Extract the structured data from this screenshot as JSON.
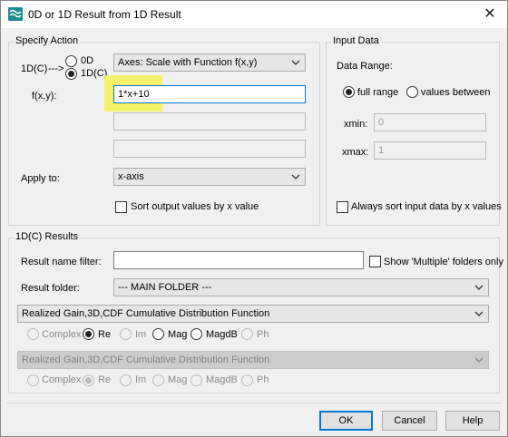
{
  "window": {
    "title": "0D or 1D Result from 1D Result",
    "close_glyph": "✕"
  },
  "specify_action": {
    "group_label": "Specify Action",
    "source_label": "1D(C)",
    "arrow": "--->",
    "radio_0d": "0D",
    "radio_1dc": "1D(C)",
    "action_select": "Axes: Scale with Function f(x,y)",
    "fxy_label": "f(x,y):",
    "fxy_value": "1*x+10",
    "apply_to_label": "Apply to:",
    "apply_to_select": "x-axis",
    "sort_output_label": "Sort output values by x value"
  },
  "input_data": {
    "group_label": "Input Data",
    "data_range_label": "Data Range:",
    "full_range_label": "full range",
    "values_between_label": "values between",
    "xmin_label": "xmin:",
    "xmin_value": "0",
    "xmax_label": "xmax:",
    "xmax_value": "1",
    "always_sort_label": "Always sort input data by x values"
  },
  "results": {
    "group_label": "1D(C) Results",
    "name_filter_label": "Result name filter:",
    "name_filter_value": "",
    "multiple_only_label": "Show 'Multiple' folders only",
    "folder_label": "Result folder:",
    "folder_select": "--- MAIN FOLDER ---",
    "result1_select": "Realized Gain,3D,CDF Cumulative Distribution Function",
    "result2_select": "Realized Gain,3D,CDF Cumulative Distribution Function",
    "parts": [
      "Complex",
      "Re",
      "Im",
      "Mag",
      "MagdB",
      "Ph"
    ]
  },
  "buttons": {
    "ok": "OK",
    "cancel": "Cancel",
    "help": "Help"
  },
  "colors": {
    "highlight": "#f7f255",
    "focus_border": "#0078d7",
    "app_icon": "#1d8b93"
  }
}
